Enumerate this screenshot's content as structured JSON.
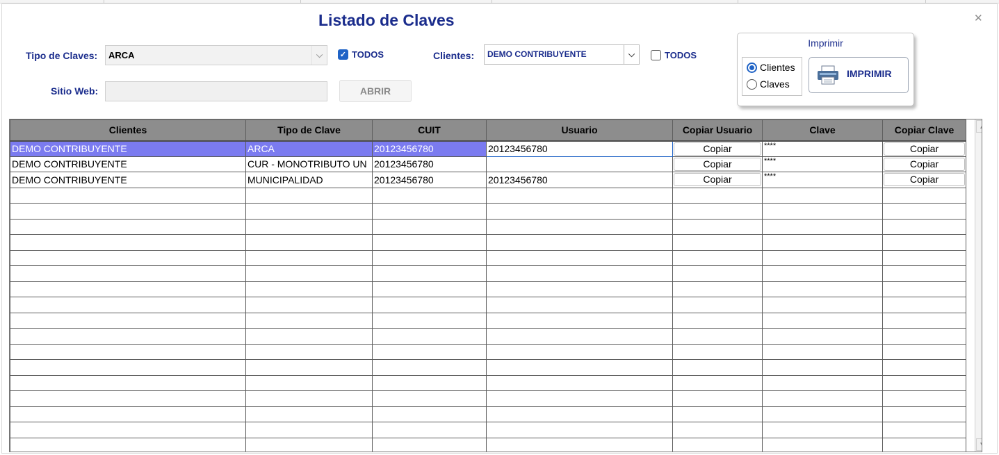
{
  "title": "Listado de Claves",
  "filters": {
    "tipo_label": "Tipo de Claves:",
    "tipo_value": "ARCA",
    "tipo_todos_label": "TODOS",
    "tipo_todos_checked": true,
    "clientes_label": "Clientes:",
    "clientes_value": "DEMO CONTRIBUYENTE",
    "clientes_todos_label": "TODOS",
    "clientes_todos_checked": false,
    "sitio_label": "Sitio Web:",
    "sitio_value": "",
    "abrir_label": "ABRIR"
  },
  "print": {
    "title": "Imprimir",
    "option_clientes": "Clientes",
    "option_claves": "Claves",
    "selected": "Clientes",
    "button_label": "IMPRIMIR"
  },
  "table": {
    "headers": [
      "Clientes",
      "Tipo de Clave",
      "CUIT",
      "Usuario",
      "Copiar Usuario",
      "Clave",
      "Copiar Clave"
    ],
    "rows": [
      {
        "cliente": "DEMO CONTRIBUYENTE",
        "tipo": "ARCA",
        "cuit": "20123456780",
        "usuario": "20123456780",
        "copiar_usuario": "Copiar",
        "clave": "****",
        "copiar_clave": "Copiar"
      },
      {
        "cliente": "DEMO CONTRIBUYENTE",
        "tipo": "CUR - MONOTRIBUTO UN",
        "cuit": "20123456780",
        "usuario": "",
        "copiar_usuario": "Copiar",
        "clave": "****",
        "copiar_clave": "Copiar"
      },
      {
        "cliente": "DEMO CONTRIBUYENTE",
        "tipo": "MUNICIPALIDAD",
        "cuit": "20123456780",
        "usuario": "20123456780",
        "copiar_usuario": "Copiar",
        "clave": "****",
        "copiar_clave": "Copiar"
      }
    ],
    "empty_rows": 17
  },
  "icons": {
    "close": "close-icon",
    "printer": "printer-icon"
  },
  "colors": {
    "accent": "#1a2c8c",
    "selection": "#7b7bf0",
    "header_bg": "#8d8d8d",
    "check_blue": "#1f63c6"
  }
}
